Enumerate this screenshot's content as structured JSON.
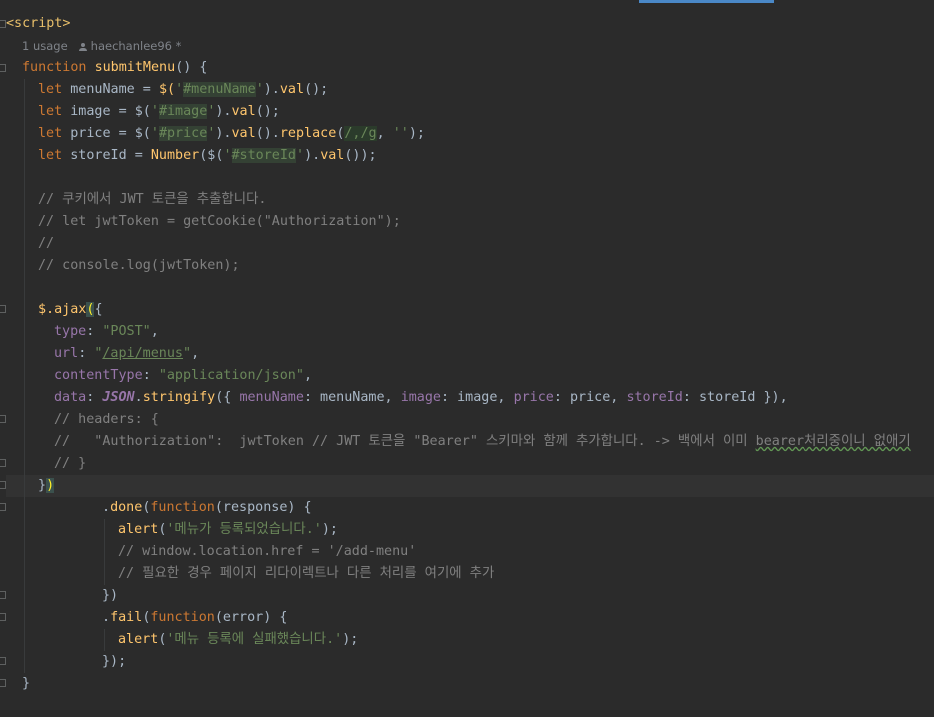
{
  "editor": {
    "script_open_tag": "<script>",
    "inlay": {
      "usages": "1 usage",
      "author": "haechanlee96 *"
    },
    "lines": {
      "l3_kw": "function",
      "l3_name": "submitMenu",
      "l3_rest": "() {",
      "l4_kw": "let",
      "l4_a": " menuName = ",
      "l4_b": "$(",
      "l4_str1": "'",
      "l4_sel": "#menuName",
      "l4_str2": "'",
      "l4_c": ").",
      "l4_fn": "val",
      "l4_d": "();",
      "l5_kw": "let",
      "l5_a": " image = $(",
      "l5_str1": "'",
      "l5_sel": "#image",
      "l5_str2": "'",
      "l5_b": ").",
      "l5_fn": "val",
      "l5_c": "();",
      "l6_kw": "let",
      "l6_a": " price = $(",
      "l6_str1": "'",
      "l6_sel": "#price",
      "l6_str2": "'",
      "l6_b": ").",
      "l6_fn1": "val",
      "l6_c": "().",
      "l6_fn2": "replace",
      "l6_d": "(",
      "l6_re": "/,/g",
      "l6_e": ", ",
      "l6_str3": "''",
      "l6_f": ");",
      "l7_kw": "let",
      "l7_a": " storeId = ",
      "l7_fn0": "Number",
      "l7_b": "($(",
      "l7_str1": "'",
      "l7_sel": "#storeId",
      "l7_str2": "'",
      "l7_c": ").",
      "l7_fn": "val",
      "l7_d": "());",
      "c1": "// 쿠키에서 JWT 토큰을 추출합니다.",
      "c2": "// let jwtToken = getCookie(\"Authorization\");",
      "c3": "//",
      "c4": "// console.log(jwtToken);",
      "ajax_a": "$.",
      "ajax_fn": "ajax",
      "ajax_paren": "(",
      "ajax_brace": "{",
      "type_key": "type",
      "type_val": "\"POST\"",
      "url_key": "url",
      "url_val_q1": "\"",
      "url_val": "/api/menus",
      "url_val_q2": "\"",
      "ct_key": "contentType",
      "ct_val": "\"application/json\"",
      "data_key": "data",
      "data_json": "JSON",
      "data_fn": "stringify",
      "data_a": "({ ",
      "data_k1": "menuName",
      "data_v1": ": menuName, ",
      "data_k2": "image",
      "data_v2": ": image, ",
      "data_k3": "price",
      "data_v3": ": price, ",
      "data_k4": "storeId",
      "data_v4": ": storeId }),",
      "h1": "// headers: {",
      "h2_a": "//   \"Authorization\":  jwtToken // JWT 토큰을 \"Bearer\" 스키마와 함께 추가합니다. -> 백에서 이미 ",
      "h2_b": "bearer",
      "h2_c": "처리중이니 없애기",
      "h3": "// }",
      "close_brace": "}",
      "close_paren": ")",
      "done_a": ".",
      "done_fn": "done",
      "done_b": "(",
      "done_kw": "function",
      "done_c": "(response) {",
      "alert1_fn": "alert",
      "alert1_a": "(",
      "alert1_str": "'메뉴가 등록되었습니다.'",
      "alert1_b": ");",
      "c5": "// window.location.href = '/add-menu'",
      "c6": "// 필요한 경우 페이지 리다이렉트나 다른 처리를 여기에 추가",
      "done_close": "})",
      "fail_a": ".",
      "fail_fn": "fail",
      "fail_b": "(",
      "fail_kw": "function",
      "fail_c": "(error) {",
      "alert2_fn": "alert",
      "alert2_a": "(",
      "alert2_str": "'메뉴 등록에 실패했습니다.'",
      "alert2_b": ");",
      "fail_close": "});",
      "func_close": "}"
    }
  },
  "colors": {
    "background": "#2b2b2b",
    "keyword": "#cc7832",
    "function": "#ffc66d",
    "string": "#6a8759",
    "property": "#9876aa",
    "comment": "#808080",
    "tag": "#e8bf6a",
    "accent": "#4a88c7"
  }
}
